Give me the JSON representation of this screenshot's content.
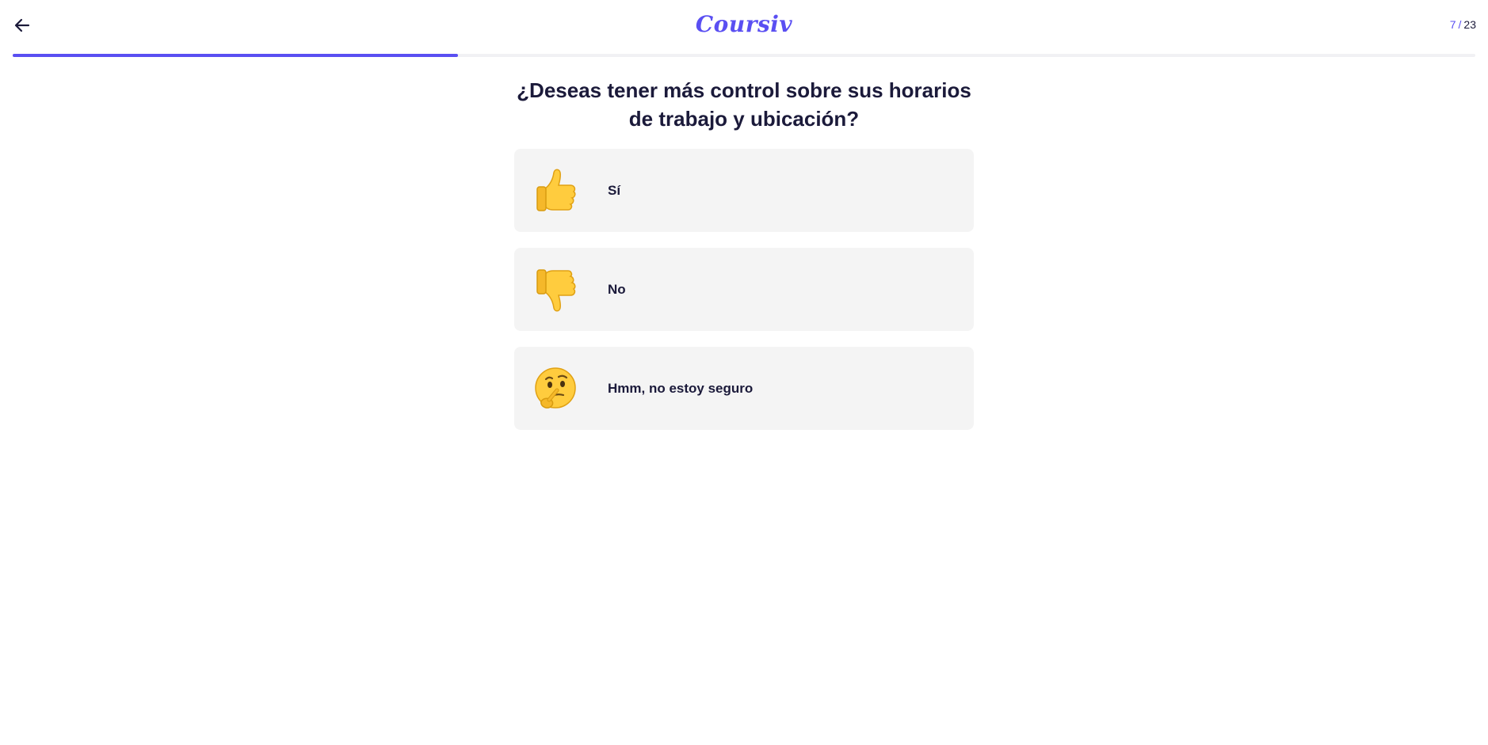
{
  "header": {
    "back_icon": "arrow-left-icon",
    "logo_text": "Coursiv",
    "step_current": "7",
    "step_separator": "/",
    "step_total": "23",
    "progress_fraction": 0.3043,
    "accent_color": "#5a4ff2"
  },
  "question": {
    "title": "¿Deseas tener más control sobre sus horarios de trabajo y ubicación?"
  },
  "options": [
    {
      "icon": "thumbs-up-icon",
      "label": "Sí"
    },
    {
      "icon": "thumbs-down-icon",
      "label": "No"
    },
    {
      "icon": "thinking-face-icon",
      "label": "Hmm, no estoy seguro"
    }
  ]
}
